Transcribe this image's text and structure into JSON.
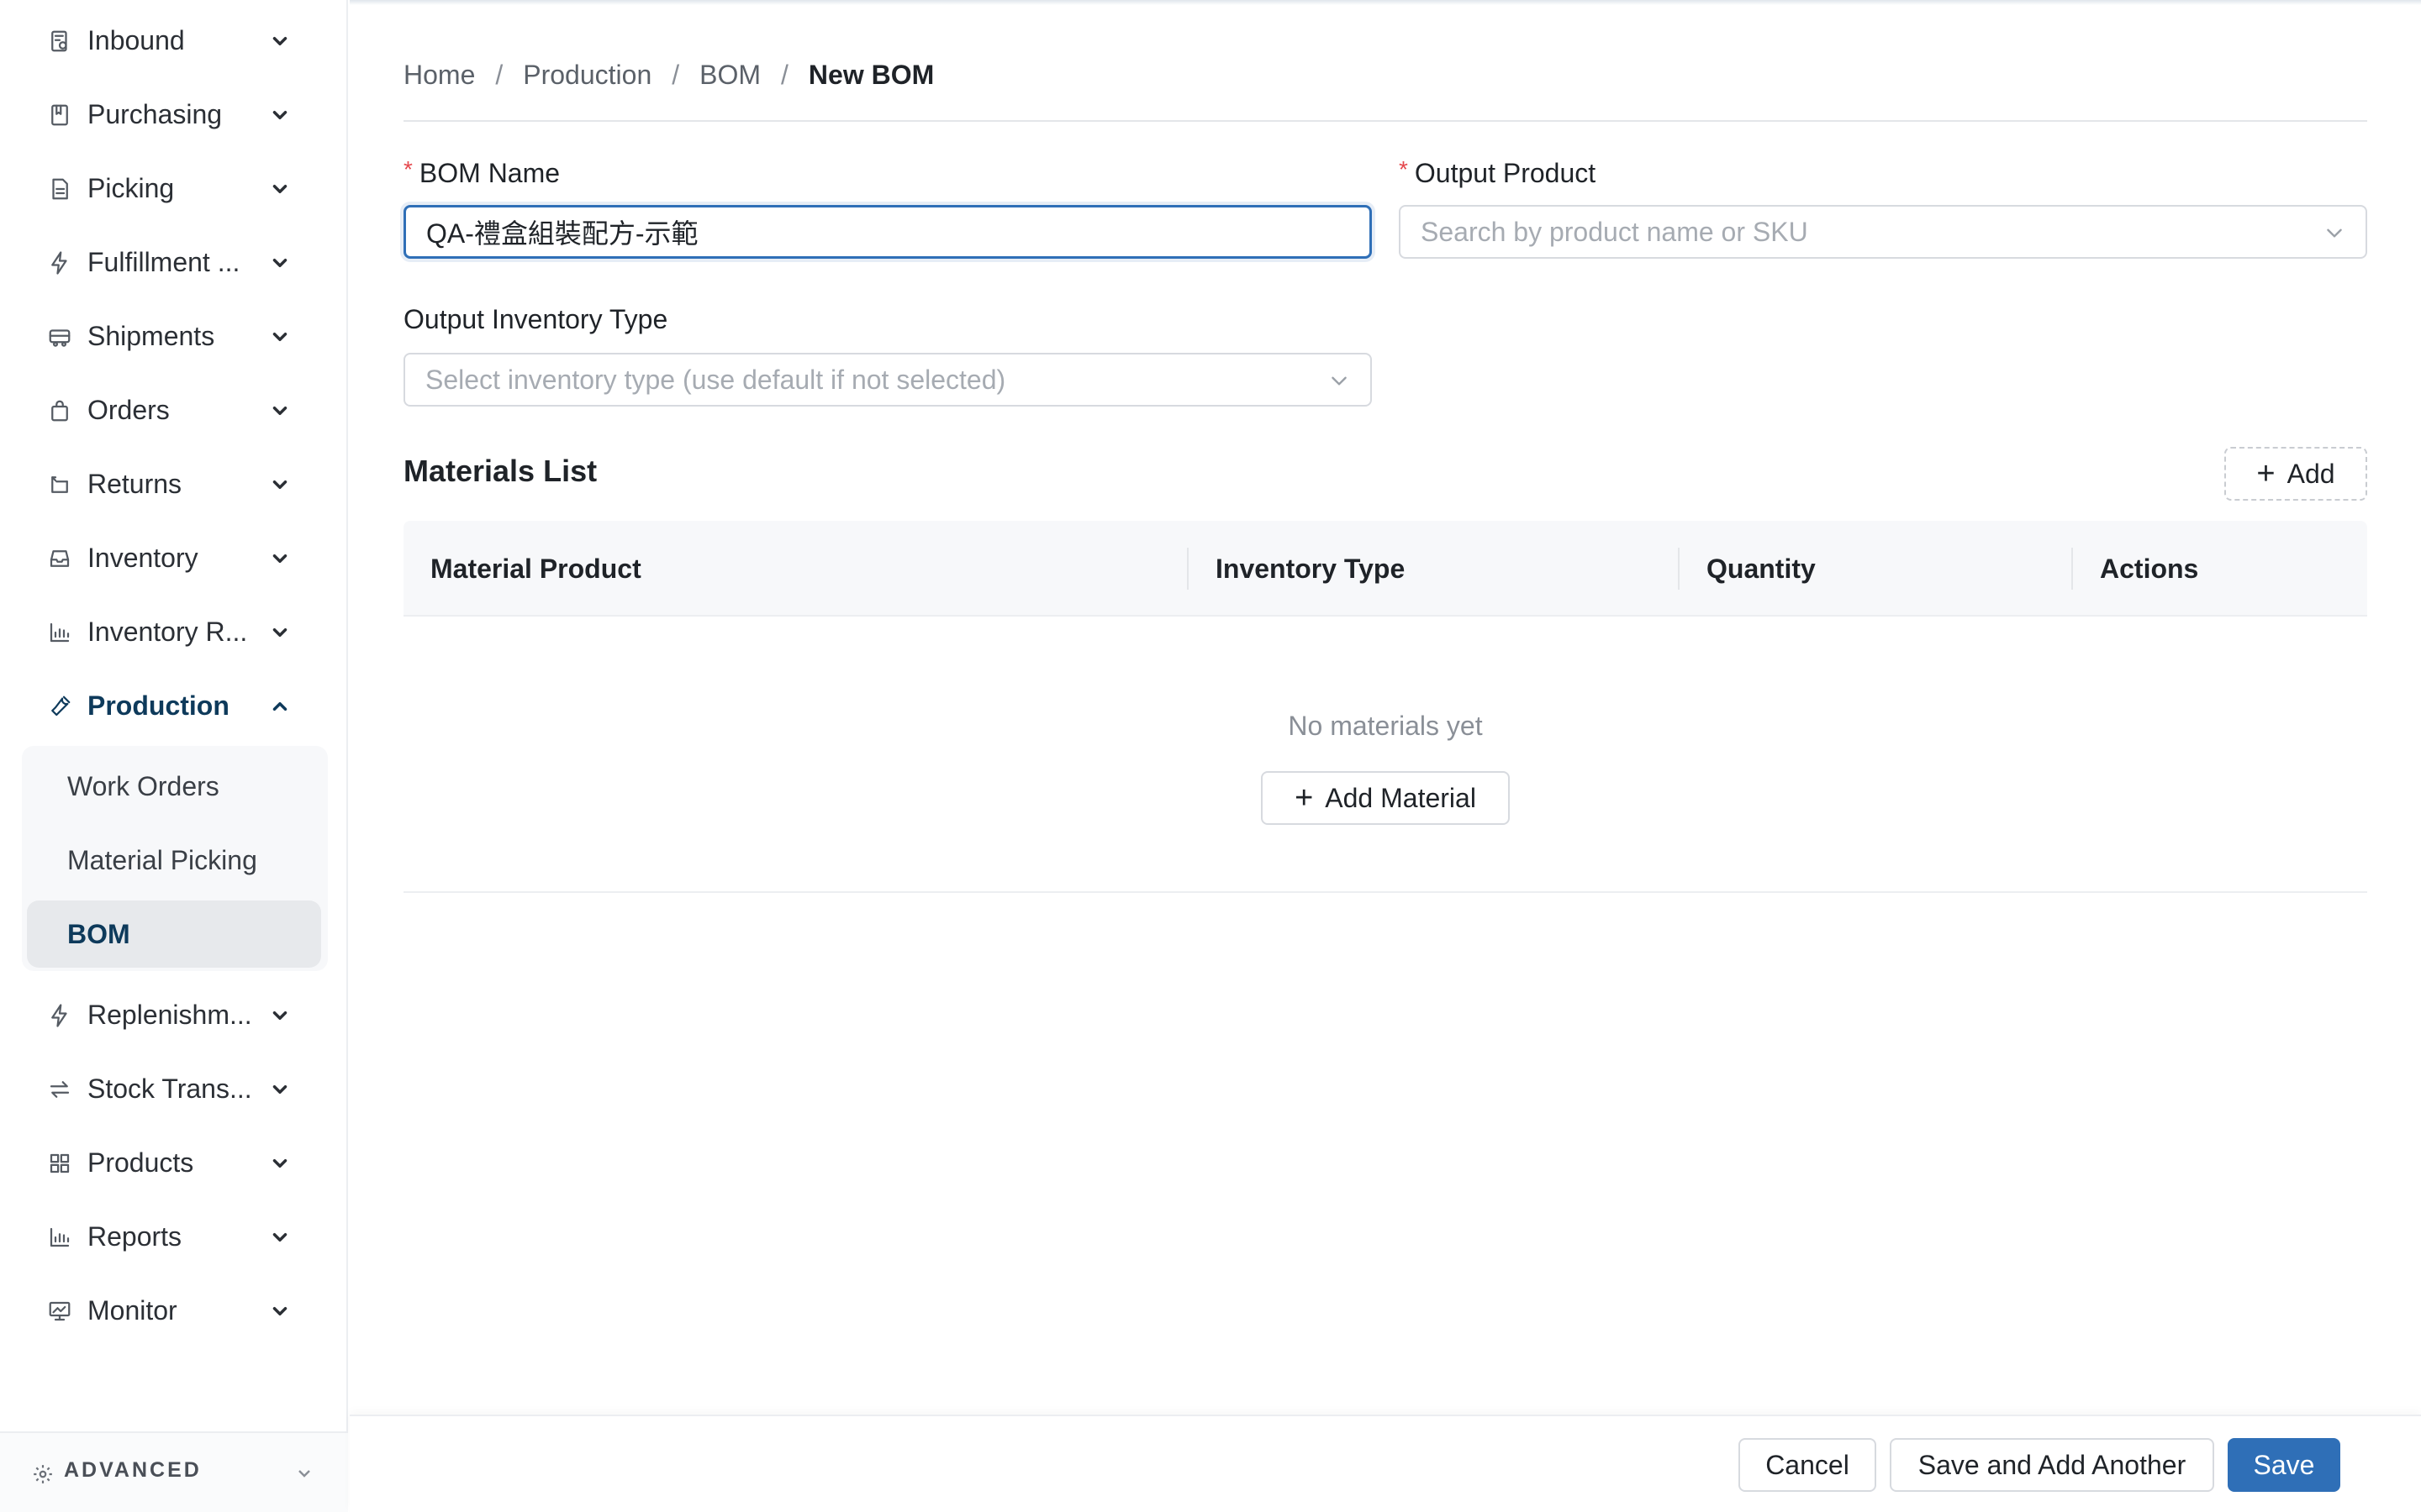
{
  "sidebar": {
    "items": [
      {
        "label": "Inbound",
        "icon": "inbound-icon"
      },
      {
        "label": "Purchasing",
        "icon": "purchasing-icon"
      },
      {
        "label": "Picking",
        "icon": "picking-icon"
      },
      {
        "label": "Fulfillment ...",
        "icon": "lightning-icon"
      },
      {
        "label": "Shipments",
        "icon": "truck-icon"
      },
      {
        "label": "Orders",
        "icon": "shopping-bag-icon"
      },
      {
        "label": "Returns",
        "icon": "return-icon"
      },
      {
        "label": "Inventory",
        "icon": "inbox-icon"
      },
      {
        "label": "Inventory R...",
        "icon": "bar-chart-icon"
      },
      {
        "label": "Production",
        "icon": "wrench-icon"
      },
      {
        "label": "Replenishm...",
        "icon": "lightning-icon"
      },
      {
        "label": "Stock Trans...",
        "icon": "transfer-icon"
      },
      {
        "label": "Products",
        "icon": "grid-icon"
      },
      {
        "label": "Reports",
        "icon": "bar-chart-icon"
      },
      {
        "label": "Monitor",
        "icon": "monitor-icon"
      }
    ],
    "production_submenu": [
      "Work Orders",
      "Material Picking",
      "BOM"
    ],
    "advanced_label": "ADVANCED"
  },
  "breadcrumb": {
    "items": [
      "Home",
      "Production",
      "BOM"
    ],
    "current": "New BOM",
    "separator": "/"
  },
  "form": {
    "bom_name": {
      "label": "BOM Name",
      "required_mark": "*",
      "value": "QA-禮盒組裝配方-示範"
    },
    "output_product": {
      "label": "Output Product",
      "required_mark": "*",
      "placeholder": "Search by product name or SKU"
    },
    "output_inventory_type": {
      "label": "Output Inventory Type",
      "placeholder": "Select inventory type (use default if not selected)"
    }
  },
  "materials": {
    "title": "Materials List",
    "add_label": "Add",
    "columns": [
      "Material Product",
      "Inventory Type",
      "Quantity",
      "Actions"
    ],
    "empty_text": "No materials yet",
    "add_material_label": "Add Material"
  },
  "footer": {
    "cancel_label": "Cancel",
    "save_another_label": "Save and Add Another",
    "save_label": "Save"
  },
  "colors": {
    "accent": "#2f6fb7",
    "active_nav": "#0e3a5b",
    "required": "#e5484d"
  }
}
